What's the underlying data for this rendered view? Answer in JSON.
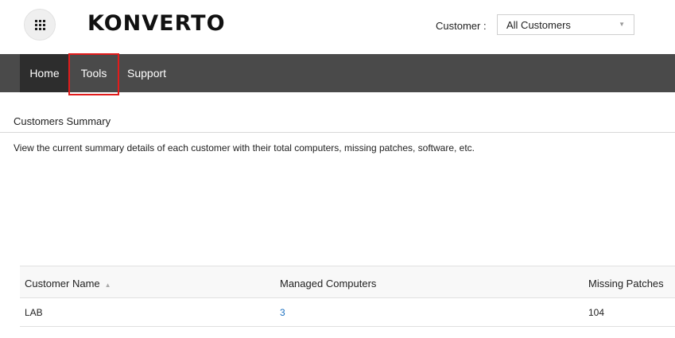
{
  "header": {
    "apps_icon": "apps-grid-icon",
    "logo_text": "KONVERTO",
    "customer_label": "Customer :",
    "customer_select": {
      "value": "All Customers",
      "caret_icon": "caret-down-icon"
    }
  },
  "nav": {
    "items": [
      {
        "label": "Home",
        "active": true
      },
      {
        "label": "Tools",
        "highlighted": true
      },
      {
        "label": "Support"
      }
    ]
  },
  "main": {
    "section_title": "Customers Summary",
    "description": "View the current summary details of each customer with their total computers, missing patches, software, etc."
  },
  "table": {
    "columns": [
      "Customer Name",
      "Managed Computers",
      "Missing Patches"
    ],
    "sort_icon": "sort-ascending-icon",
    "rows": [
      {
        "customer": "LAB",
        "computers": "3",
        "patches": "104"
      }
    ]
  },
  "colors": {
    "navbar": "#4a4a4a",
    "nav_active": "#2d2d2d",
    "highlight": "#e21b1b",
    "link": "#1a6fc0"
  }
}
